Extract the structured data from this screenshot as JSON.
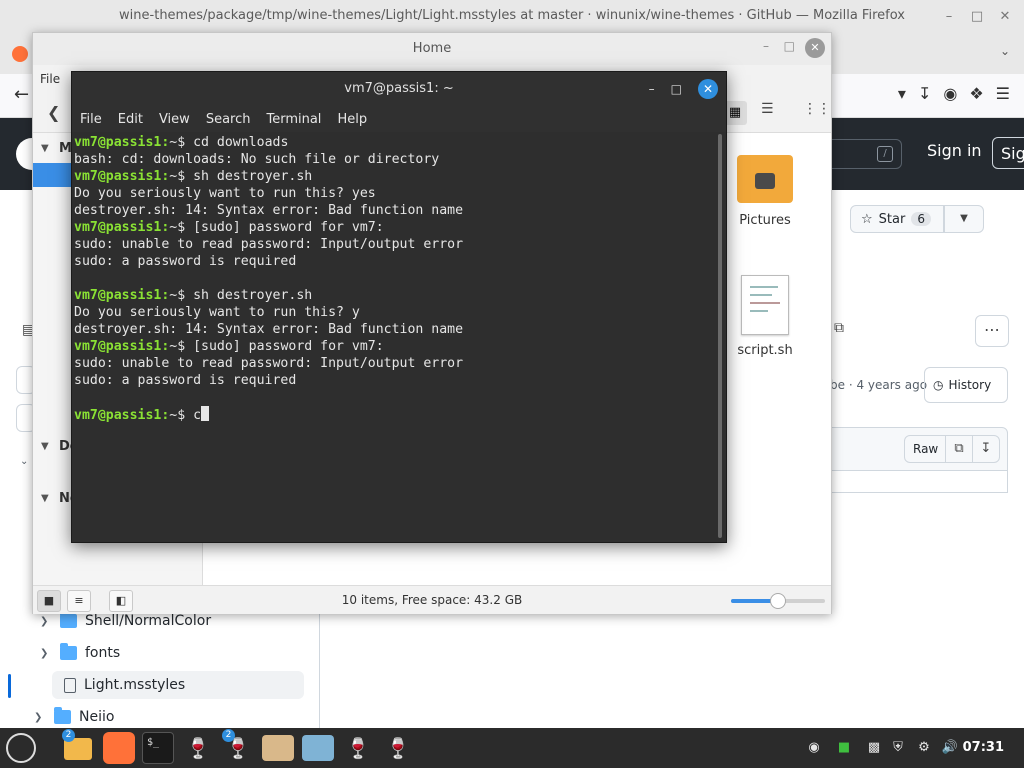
{
  "firefox": {
    "title": "wine-themes/package/tmp/wine-themes/Light/Light.msstyles at master · winunix/wine-themes · GitHub — Mozilla Firefox",
    "github": {
      "search_slash": "/",
      "sign_in": "Sign in",
      "sign_up": "Sig",
      "star_label": "Star",
      "star_count": "6",
      "commit_time": "be · 4 years ago",
      "history_label": "History",
      "raw_label": "Raw",
      "tree": [
        {
          "name": "Shell/NormalColor",
          "type": "folder"
        },
        {
          "name": "fonts",
          "type": "folder"
        },
        {
          "name": "Light.msstyles",
          "type": "file"
        },
        {
          "name": "Neiio",
          "type": "folder"
        }
      ]
    }
  },
  "nemo": {
    "title": "Home",
    "menu_first": "File",
    "sidebar_fragments": [
      "M",
      "De",
      "Ne"
    ],
    "items": [
      {
        "label": "Pictures",
        "icon": "pictures-folder-icon"
      },
      {
        "label": "script.sh",
        "icon": "script-file-icon"
      }
    ],
    "status": "10 items, Free space: 43.2 GB",
    "zoom_level": 0.5
  },
  "terminal": {
    "title": "vm7@passis1: ~",
    "menu": [
      "File",
      "Edit",
      "View",
      "Search",
      "Terminal",
      "Help"
    ],
    "lines": [
      {
        "prompt": "vm7@passis1:",
        "path": "~$ ",
        "text": "cd downloads"
      },
      {
        "prompt": "",
        "path": "",
        "text": "bash: cd: downloads: No such file or directory"
      },
      {
        "prompt": "vm7@passis1:",
        "path": "~$ ",
        "text": "sh destroyer.sh"
      },
      {
        "prompt": "",
        "path": "",
        "text": "Do you seriously want to run this? yes"
      },
      {
        "prompt": "",
        "path": "",
        "text": "destroyer.sh: 14: Syntax error: Bad function name"
      },
      {
        "prompt": "vm7@passis1:",
        "path": "~$ ",
        "text": "[sudo] password for vm7:"
      },
      {
        "prompt": "",
        "path": "",
        "text": "sudo: unable to read password: Input/output error"
      },
      {
        "prompt": "",
        "path": "",
        "text": "sudo: a password is required"
      },
      {
        "prompt": "",
        "path": "",
        "text": ""
      },
      {
        "prompt": "vm7@passis1:",
        "path": "~$ ",
        "text": "sh destroyer.sh"
      },
      {
        "prompt": "",
        "path": "",
        "text": "Do you seriously want to run this? y"
      },
      {
        "prompt": "",
        "path": "",
        "text": "destroyer.sh: 14: Syntax error: Bad function name"
      },
      {
        "prompt": "vm7@passis1:",
        "path": "~$ ",
        "text": "[sudo] password for vm7:"
      },
      {
        "prompt": "",
        "path": "",
        "text": "sudo: unable to read password: Input/output error"
      },
      {
        "prompt": "",
        "path": "",
        "text": "sudo: a password is required"
      },
      {
        "prompt": "",
        "path": "",
        "text": ""
      },
      {
        "prompt": "vm7@passis1:",
        "path": "~$ ",
        "text": "c",
        "cursor": true
      }
    ]
  },
  "taskbar": {
    "badges": [
      "2",
      "2"
    ],
    "clock": "07:31"
  },
  "colors": {
    "prompt_green": "#8ae234",
    "terminal_bg": "#2e2e2e",
    "accent_blue": "#2f8fde",
    "github_header": "#24292f"
  }
}
